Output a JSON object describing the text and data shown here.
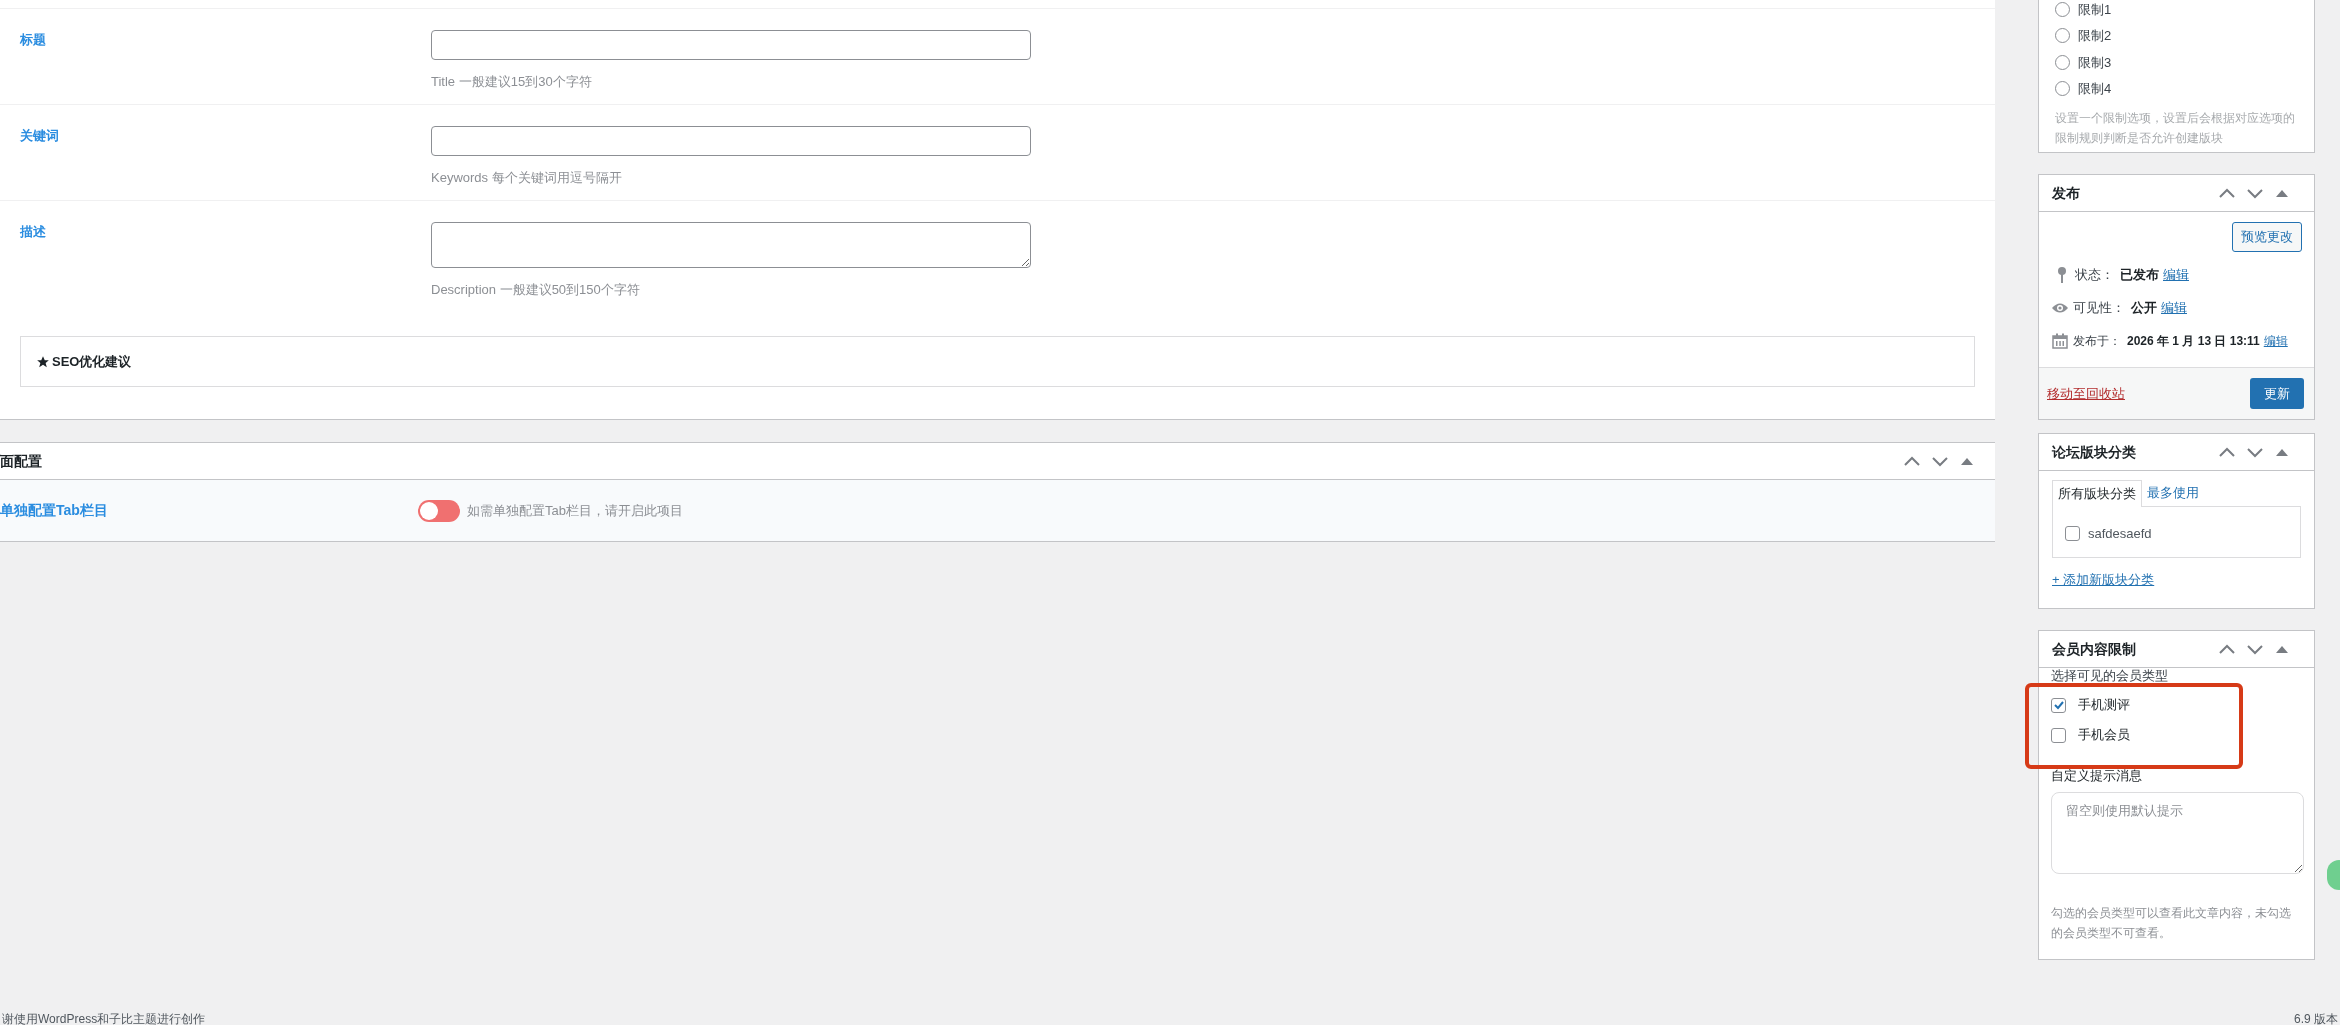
{
  "seo_panel": {
    "fields": [
      {
        "kind": "input",
        "label": "标题",
        "hint": "Title 一般建议15到30个字符"
      },
      {
        "kind": "input",
        "label": "关键词",
        "hint": "Keywords 每个关键词用逗号隔开"
      },
      {
        "kind": "textarea",
        "label": "描述",
        "hint": "Description 一般建议50到150个字符"
      }
    ],
    "suggestion": "SEO优化建议"
  },
  "page_config_panel": {
    "title": "面配置",
    "option": {
      "label": "单独配置Tab栏目",
      "on": false,
      "hint": "如需单独配置Tab栏目，请开启此项目"
    }
  },
  "restriction_panel": {
    "options": [
      {
        "label": "限制1",
        "selected": false
      },
      {
        "label": "限制2",
        "selected": false
      },
      {
        "label": "限制3",
        "selected": false
      },
      {
        "label": "限制4",
        "selected": false
      }
    ],
    "help": "设置一个限制选项，设置后会根据对应选项的限制规则判断是否允许创建版块"
  },
  "publish_panel": {
    "title": "发布",
    "preview_button": "预览更改",
    "rows": [
      {
        "kind": "status",
        "label": "状态：",
        "value": "已发布",
        "link": "编辑"
      },
      {
        "kind": "visibility",
        "label": "可见性：",
        "value": "公开",
        "link": "编辑"
      },
      {
        "kind": "date",
        "label": "发布于：",
        "value": "2026 年 1 月 13 日 13:11",
        "link": "编辑"
      }
    ],
    "trash_link": "移动至回收站",
    "update_button": "更新"
  },
  "category_panel": {
    "title": "论坛版块分类",
    "tabs": [
      {
        "label": "所有版块分类",
        "selected": true
      },
      {
        "label": "最多使用",
        "selected": false
      }
    ],
    "items": [
      {
        "label": "safdesaefd",
        "checked": false
      }
    ],
    "add_link": "+ 添加新版块分类"
  },
  "member_panel": {
    "title": "会员内容限制",
    "label": "选择可见的会员类型",
    "items": [
      {
        "label": "手机测评",
        "checked": true
      },
      {
        "label": "手机会员",
        "checked": false
      }
    ],
    "message_label": "自定义提示消息",
    "message_placeholder": "留空则使用默认提示",
    "help": "勾选的会员类型可以查看此文章内容，未勾选的会员类型不可查看。"
  },
  "footer": {
    "left": "谢使用WordPress和子比主题进行创作",
    "right": "6.9 版本"
  }
}
